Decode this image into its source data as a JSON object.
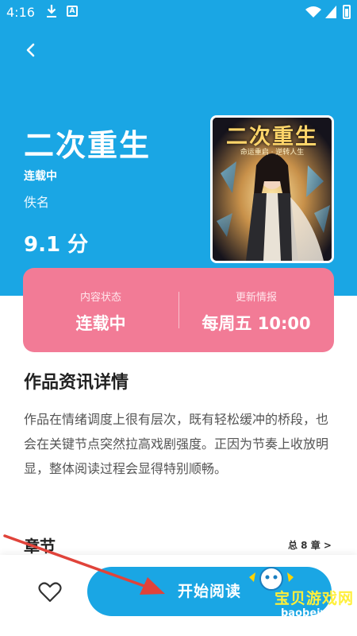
{
  "status_bar": {
    "time": "4:16"
  },
  "book": {
    "title": "二次重生",
    "status_tag": "连载中",
    "author": "佚名",
    "score": "9.1 分",
    "cover_title": "二次重生",
    "cover_subtitle": "命运重启 · 逆转人生"
  },
  "info_card": {
    "left_label": "内容状态",
    "left_value": "连载中",
    "right_label": "更新情报",
    "right_value": "每周五 10:00"
  },
  "detail": {
    "section_title": "作品资讯详情",
    "description": "作品在情绪调度上很有层次，既有轻松缓冲的桥段，也会在关键节点突然拉高戏剧强度。正因为节奏上收放明显，整体阅读过程会显得特别顺畅。"
  },
  "chapters": {
    "title": "章节",
    "total": "总 8 章 >"
  },
  "bottom": {
    "read_button": "开始阅读"
  },
  "watermark": {
    "text": "宝贝游戏网",
    "url": "baobeiy.com"
  },
  "colors": {
    "header": "#1aa6e4",
    "card": "#f27b96",
    "button": "#1aa6e4",
    "watermark_yellow": "#ffef3a"
  },
  "icons": [
    "download-icon",
    "a-badge-icon",
    "wifi-icon",
    "signal-icon",
    "battery-icon",
    "back-arrow-icon",
    "heart-icon",
    "red-arrow-icon"
  ]
}
